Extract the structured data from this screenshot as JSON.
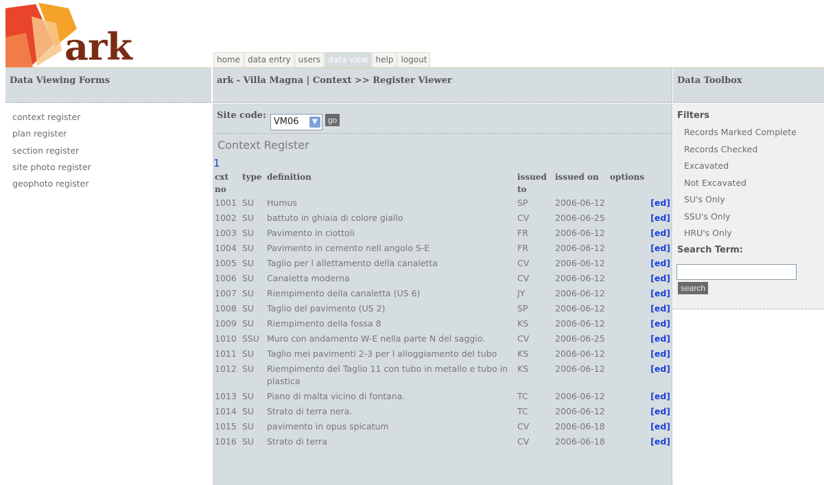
{
  "brand": {
    "logo_text": "ark"
  },
  "nav": [
    {
      "label": "home",
      "active": false
    },
    {
      "label": "data entry",
      "active": false
    },
    {
      "label": "users",
      "active": false
    },
    {
      "label": "data view",
      "active": true
    },
    {
      "label": "help",
      "active": false
    },
    {
      "label": "logout",
      "active": false
    }
  ],
  "left": {
    "header": "Data Viewing Forms",
    "items": [
      "context register",
      "plan register",
      "section register",
      "site photo register",
      "geophoto register"
    ]
  },
  "main": {
    "header": "ark - Villa Magna | Context >> Register Viewer",
    "site_label": "Site code:",
    "site_value": "VM06",
    "go_label": "go",
    "register_title": "Context Register",
    "page_link": "1",
    "columns": [
      "cxt no",
      "type",
      "definition",
      "issued to",
      "issued on",
      "options"
    ],
    "rows": [
      [
        "1001",
        "SU",
        "Humus",
        "SP",
        "2006-06-12",
        "[ed]"
      ],
      [
        "1002",
        "SU",
        "battuto in ghiaia di colore giallo",
        "CV",
        "2006-06-25",
        "[ed]"
      ],
      [
        "1003",
        "SU",
        "Pavimento in ciottoli",
        "FR",
        "2006-06-12",
        "[ed]"
      ],
      [
        "1004",
        "SU",
        "Pavimento in cemento nell angolo S-E",
        "FR",
        "2006-06-12",
        "[ed]"
      ],
      [
        "1005",
        "SU",
        "Taglio per l allettamento della canaletta",
        "CV",
        "2006-06-12",
        "[ed]"
      ],
      [
        "1006",
        "SU",
        "Canaletta moderna",
        "CV",
        "2006-06-12",
        "[ed]"
      ],
      [
        "1007",
        "SU",
        "Riempimento della canaletta (US 6)",
        "JY",
        "2006-06-12",
        "[ed]"
      ],
      [
        "1008",
        "SU",
        "Taglio del pavimento (US 2)",
        "SP",
        "2006-06-12",
        "[ed]"
      ],
      [
        "1009",
        "SU",
        "Riempimento della fossa 8",
        "KS",
        "2006-06-12",
        "[ed]"
      ],
      [
        "1010",
        "SSU",
        "Muro con andamento W-E nella parte N del saggio.",
        "CV",
        "2006-06-25",
        "[ed]"
      ],
      [
        "1011",
        "SU",
        "Taglio mei pavimenti 2-3 per l alloggiamento del tubo",
        "KS",
        "2006-06-12",
        "[ed]"
      ],
      [
        "1012",
        "SU",
        "Riempimento del Taglio 11 con tubo in metallo e tubo in plastica",
        "KS",
        "2006-06-12",
        "[ed]"
      ],
      [
        "1013",
        "SU",
        "Piano di malta vicino di fontana.",
        "TC",
        "2006-06-12",
        "[ed]"
      ],
      [
        "1014",
        "SU",
        "Strato di terra nera.",
        "TC",
        "2006-06-12",
        "[ed]"
      ],
      [
        "1015",
        "SU",
        "pavimento in opus spicatum",
        "CV",
        "2006-06-18",
        "[ed]"
      ],
      [
        "1016",
        "SU",
        "Strato di terra",
        "CV",
        "2006-06-18",
        "[ed]"
      ]
    ]
  },
  "right": {
    "header": "Data Toolbox",
    "filters_title": "Filters",
    "filters": [
      "Records Marked Complete",
      "Records Checked",
      "Excavated",
      "Not Excavated",
      "SU's Only",
      "SSU's Only",
      "HRU's Only"
    ],
    "search_title": "Search Term:",
    "search_value": "",
    "search_button": "search"
  }
}
